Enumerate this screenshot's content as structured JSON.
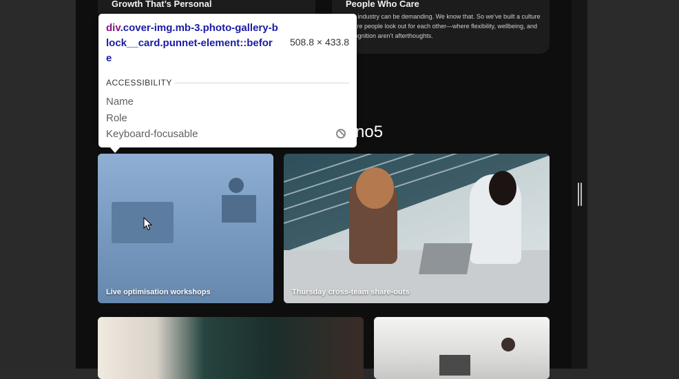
{
  "cards": {
    "left": {
      "title": "Growth That’s Personal"
    },
    "right": {
      "title": "People Who Care",
      "body": "Our industry can be demanding. We know that. So we’ve built a culture where people look out for each other—where flexibility, wellbeing, and recognition aren’t afterthoughts."
    }
  },
  "section": {
    "heading": "no5"
  },
  "gallery": {
    "captions": [
      "Live optimisation workshops",
      "Thursday cross-team share-outs",
      "",
      ""
    ]
  },
  "inspector": {
    "tag": "div",
    "selector": ".cover-img.mb-3.photo-gallery-block__card.punnet-element::before",
    "size": "508.8 × 433.8",
    "section_title": "ACCESSIBILITY",
    "rows": {
      "name": "Name",
      "role": "Role",
      "keyboard": "Keyboard-focusable"
    },
    "keyboard_icon": "not-allowed-icon"
  },
  "colors": {
    "page_bg": "#0e0e0e",
    "card_bg": "#1c1c1c",
    "selector_blue": "#1a1aa6",
    "tag_purple": "#881280",
    "highlight": "#78a0d2"
  }
}
